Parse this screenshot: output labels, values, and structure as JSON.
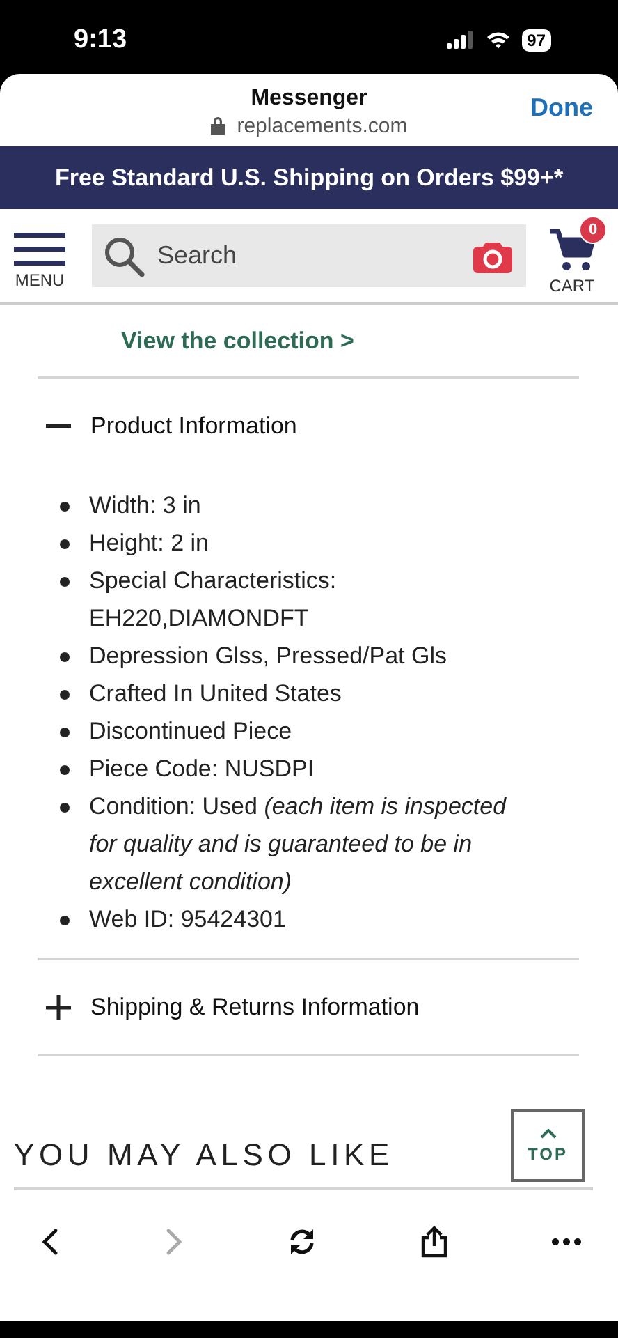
{
  "status_bar": {
    "time": "9:13",
    "battery": "97"
  },
  "browser_header": {
    "title": "Messenger",
    "url": "replacements.com",
    "done": "Done"
  },
  "promo_banner": "Free Standard U.S. Shipping on Orders $99+*",
  "site_nav": {
    "menu_label": "MENU",
    "search": {
      "placeholder": "Search"
    },
    "cart_label": "CART",
    "cart_count": "0"
  },
  "collection_link": "View the collection >",
  "sections": [
    {
      "title": "Product Information",
      "expanded": true,
      "items": [
        "Width: 3 in",
        "Height: 2 in",
        "Special Characteristics: EH220,DIAMONDFT",
        "Depression Glss, Pressed/Pat Gls",
        "Crafted In United States",
        "Discontinued Piece",
        "Piece Code: NUSDPI",
        "Condition: Used *(each item is inspected for quality and is guaranteed to be in excellent condition)*",
        "Web ID: 95424301"
      ]
    },
    {
      "title": "Shipping & Returns Information",
      "expanded": false
    }
  ],
  "related_heading": "YOU MAY ALSO LIKE",
  "top_button": "TOP",
  "toolbar": [
    {
      "kind": "back",
      "disabled": false
    },
    {
      "kind": "forward",
      "disabled": true
    },
    {
      "kind": "reload",
      "disabled": false
    },
    {
      "kind": "share",
      "disabled": false
    },
    {
      "kind": "more",
      "disabled": false
    }
  ]
}
